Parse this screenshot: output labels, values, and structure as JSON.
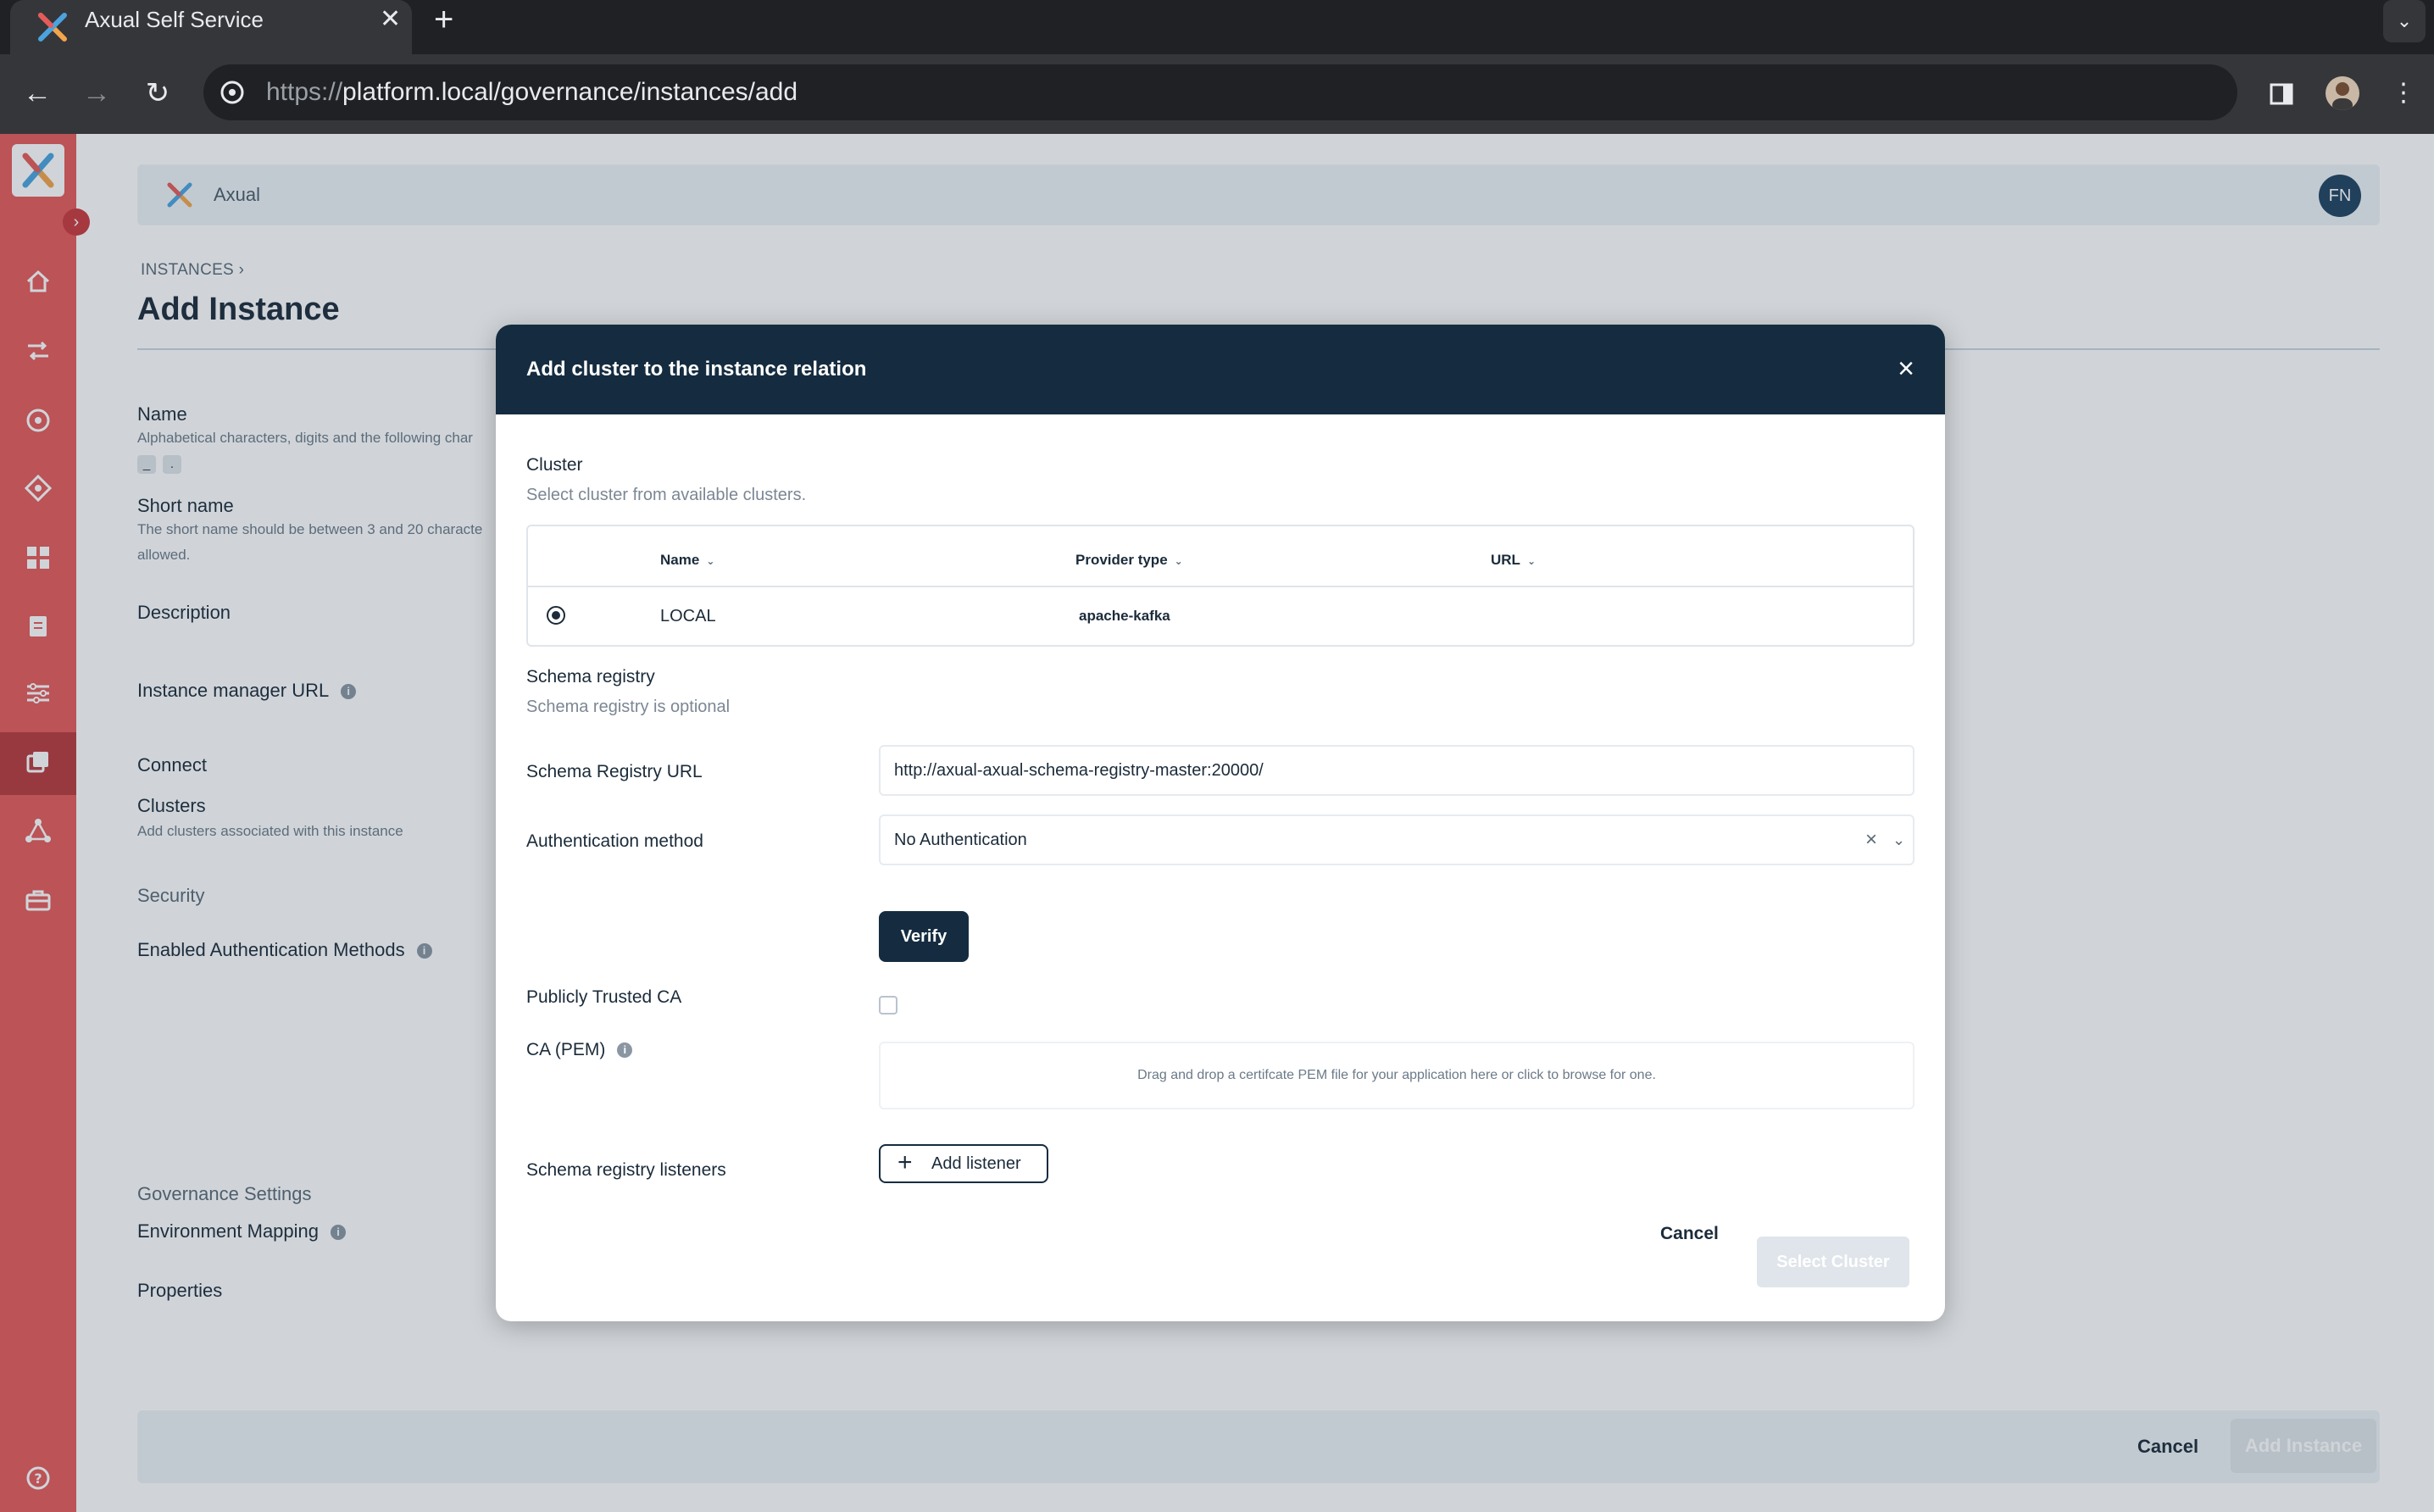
{
  "browser": {
    "tab_title": "Axual Self Service",
    "url_scheme": "https://",
    "url_host": "platform.local",
    "url_path": "/governance/instances/add"
  },
  "app": {
    "brand_name": "Axual",
    "user_initials": "FN",
    "sidebar_icons": [
      "home-icon",
      "streams-icon",
      "target-icon",
      "diamond-icon",
      "dashboard-icon",
      "clipboard-icon",
      "sliders-icon",
      "instances-icon",
      "network-icon",
      "toolbox-icon",
      "help-icon"
    ],
    "colors": {
      "sidebar": "#e55a5a",
      "sidebar_active": "#b8393d",
      "primary": "#152c40"
    }
  },
  "page": {
    "breadcrumb": "INSTANCES",
    "title": "Add Instance",
    "fields": {
      "name_label": "Name",
      "name_help": "Alphabetical characters, digits and the following char",
      "name_chips": [
        "_",
        "."
      ],
      "short_name_label": "Short name",
      "short_name_help_1": "The short name should be between 3 and 20 characte",
      "short_name_help_2": "allowed.",
      "description_label": "Description",
      "instance_manager_url_label": "Instance manager URL",
      "connect_section": "Connect",
      "clusters_label": "Clusters",
      "clusters_help": "Add clusters associated with this instance",
      "security_section": "Security",
      "enabled_auth_label": "Enabled Authentication Methods",
      "governance_section": "Governance Settings",
      "environment_mapping_label": "Environment Mapping",
      "properties_label": "Properties"
    },
    "footer": {
      "cancel": "Cancel",
      "submit": "Add Instance"
    }
  },
  "modal": {
    "title": "Add cluster to the instance relation",
    "cluster_label": "Cluster",
    "cluster_help": "Select cluster from available clusters.",
    "table": {
      "columns": [
        "Name",
        "Provider type",
        "URL"
      ],
      "rows": [
        {
          "name": "LOCAL",
          "provider_type": "apache-kafka",
          "url": "",
          "selected": true
        }
      ]
    },
    "schema_registry_label": "Schema registry",
    "schema_registry_help": "Schema registry is optional",
    "schema_registry_url_label": "Schema Registry URL",
    "schema_registry_url_value": "http://axual-axual-schema-registry-master:20000/",
    "auth_method_label": "Authentication method",
    "auth_method_value": "No Authentication",
    "verify_button": "Verify",
    "publicly_trusted_ca_label": "Publicly Trusted CA",
    "ca_pem_label": "CA (PEM)",
    "dropzone_text": "Drag and drop a certifcate PEM file for your application here or click to browse for one.",
    "listeners_label": "Schema registry listeners",
    "add_listener_button": "Add listener",
    "cancel_button": "Cancel",
    "select_button": "Select Cluster"
  }
}
